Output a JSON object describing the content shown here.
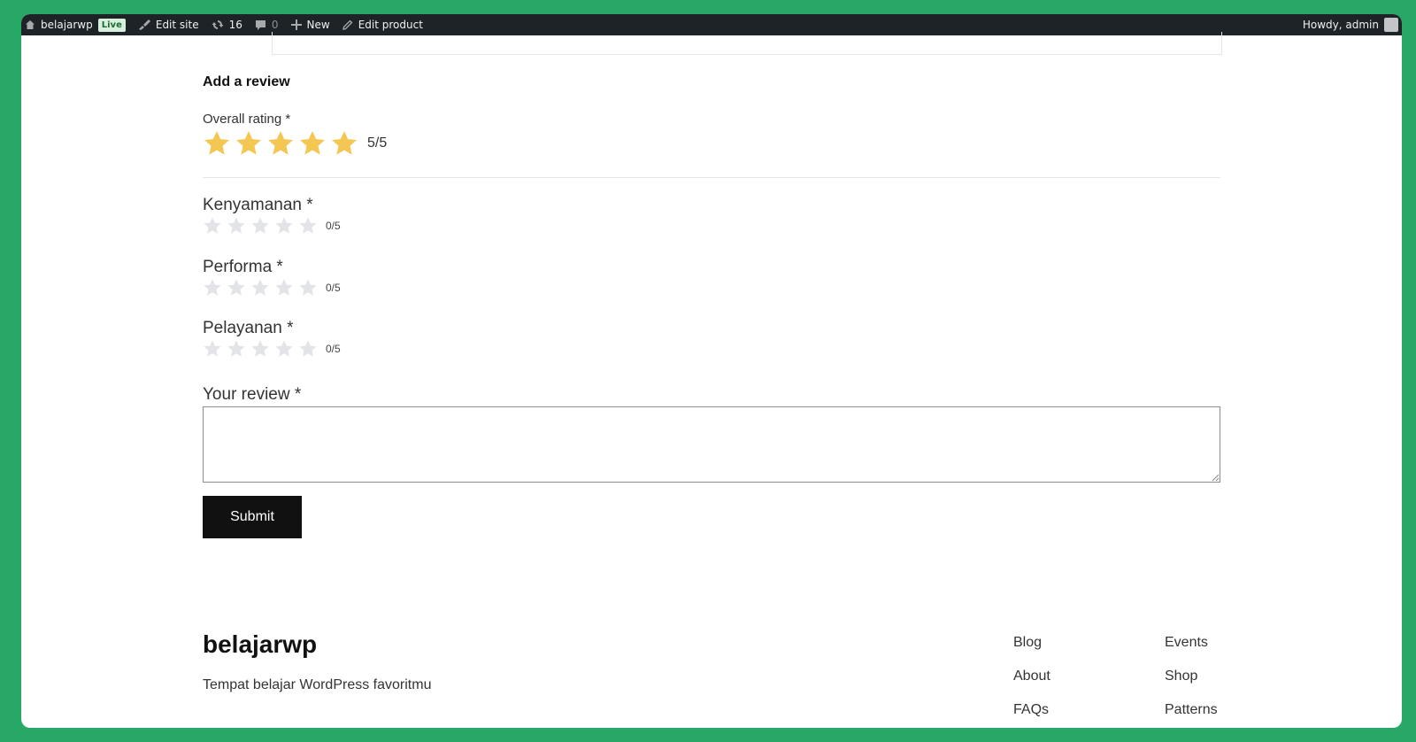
{
  "adminbar": {
    "site_name": "belajarwp",
    "live_badge": "Live",
    "edit_site": "Edit site",
    "updates_count": "16",
    "comments_count": "0",
    "new_label": "New",
    "edit_product": "Edit product",
    "howdy": "Howdy, admin"
  },
  "review": {
    "title": "Add a review",
    "overall_label": "Overall rating *",
    "overall_rating": 5,
    "overall_score": "5/5",
    "criteria": [
      {
        "label": "Kenyamanan *",
        "rating": 0,
        "score": "0/5"
      },
      {
        "label": "Performa *",
        "rating": 0,
        "score": "0/5"
      },
      {
        "label": "Pelayanan *",
        "rating": 0,
        "score": "0/5"
      }
    ],
    "review_label": "Your review *",
    "review_value": "",
    "submit_label": "Submit"
  },
  "footer": {
    "brand": "belajarwp",
    "tagline": "Tempat belajar WordPress favoritmu",
    "links_col1": [
      "Blog",
      "About",
      "FAQs"
    ],
    "links_col2": [
      "Events",
      "Shop",
      "Patterns"
    ]
  },
  "colors": {
    "star_filled": "#f4c752",
    "star_empty": "#e2e4e7",
    "background": "#27a866",
    "adminbar": "#1d2327"
  }
}
